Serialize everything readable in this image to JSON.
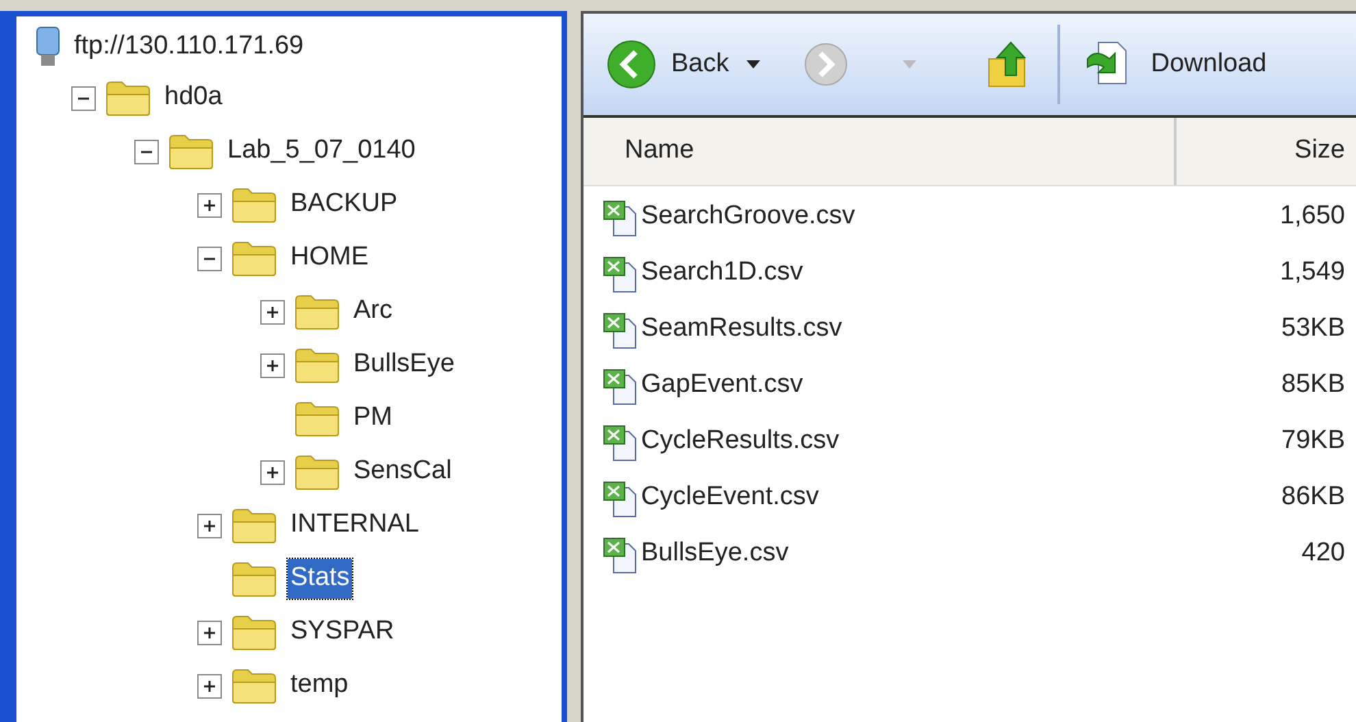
{
  "tree": {
    "label": "ftp://130.110.171.69",
    "children": [
      {
        "label": "hd0a",
        "kind": "branch",
        "expanded": true,
        "selected": false,
        "children": [
          {
            "label": "Lab_5_07_0140",
            "kind": "branch",
            "expanded": true,
            "selected": false,
            "children": [
              {
                "label": "BACKUP",
                "kind": "branch",
                "expanded": false,
                "selected": false
              },
              {
                "label": "HOME",
                "kind": "branch",
                "expanded": true,
                "selected": false,
                "children": [
                  {
                    "label": "Arc",
                    "kind": "branch",
                    "expanded": false,
                    "selected": false
                  },
                  {
                    "label": "BullsEye",
                    "kind": "branch",
                    "expanded": false,
                    "selected": false
                  },
                  {
                    "label": "PM",
                    "kind": "leaf",
                    "selected": false
                  },
                  {
                    "label": "SensCal",
                    "kind": "branch",
                    "expanded": false,
                    "selected": false
                  }
                ]
              },
              {
                "label": "INTERNAL",
                "kind": "branch",
                "expanded": false,
                "selected": false
              },
              {
                "label": "Stats",
                "kind": "leaf",
                "selected": true
              },
              {
                "label": "SYSPAR",
                "kind": "branch",
                "expanded": false,
                "selected": false
              },
              {
                "label": "temp",
                "kind": "branch",
                "expanded": false,
                "selected": false
              }
            ]
          }
        ]
      }
    ]
  },
  "toolbar": {
    "back": {
      "label": "Back",
      "disabled": false
    },
    "forward": {
      "disabled": true
    },
    "download": {
      "label": "Download"
    }
  },
  "table": {
    "columns": [
      "Name",
      "Size"
    ],
    "rows": [
      {
        "name": "SearchGroove.csv",
        "size": "1,650"
      },
      {
        "name": "Search1D.csv",
        "size": "1,549"
      },
      {
        "name": "SeamResults.csv",
        "size": "53KB"
      },
      {
        "name": "GapEvent.csv",
        "size": "85KB"
      },
      {
        "name": "CycleResults.csv",
        "size": "79KB"
      },
      {
        "name": "CycleEvent.csv",
        "size": "86KB"
      },
      {
        "name": "BullsEye.csv",
        "size": "420"
      }
    ]
  }
}
